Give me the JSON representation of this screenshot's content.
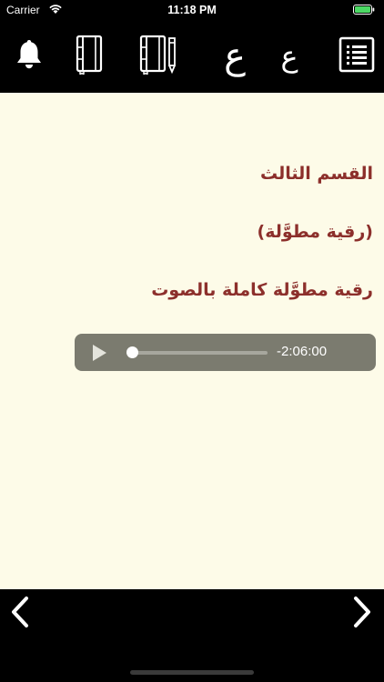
{
  "status_bar": {
    "carrier": "Carrier",
    "time": "11:18 PM",
    "icons": [
      "wifi-icon",
      "battery-icon"
    ]
  },
  "toolbar": {
    "items": [
      {
        "name": "notifications",
        "icon": "bell-icon"
      },
      {
        "name": "notebook",
        "icon": "notebook-icon"
      },
      {
        "name": "notebook-edit",
        "icon": "notebook-pencil-icon"
      },
      {
        "name": "font-large",
        "glyph": "ع"
      },
      {
        "name": "font-small",
        "glyph": "ع"
      },
      {
        "name": "contents",
        "icon": "list-icon"
      }
    ]
  },
  "content": {
    "section_title": "القسم الثالث",
    "subtitle": "(رقية مطوَّلة)",
    "audio_title": "رقية مطوَّلة كاملة بالصوت"
  },
  "audio_player": {
    "time_remaining": "-2:06:00",
    "progress": 0,
    "icons": [
      "play-icon"
    ]
  },
  "bottom_bar": {
    "icons": [
      "chevron-left-icon",
      "chevron-right-icon"
    ]
  },
  "colors": {
    "background": "#fdfbe8",
    "bars": "#000000",
    "text_accent": "#8c2f2b",
    "player": "#7b7b6f"
  }
}
